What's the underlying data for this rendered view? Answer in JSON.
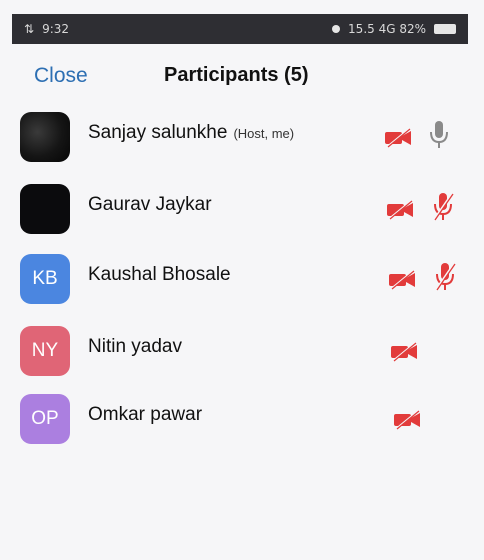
{
  "status_bar": {
    "time": "9:32",
    "right_text": "15.5 4G 82%"
  },
  "header": {
    "close_label": "Close",
    "title": "Participants (5)"
  },
  "participants": [
    {
      "name": "Sanjay salunkhe",
      "tag": "(Host, me)",
      "initials": "",
      "avatar_color": "#111111",
      "video_off": true,
      "mic_muted": false
    },
    {
      "name": "Gaurav Jaykar",
      "tag": "",
      "initials": "",
      "avatar_color": "#0b0b0d",
      "video_off": true,
      "mic_muted": true
    },
    {
      "name": "Kaushal Bhosale",
      "tag": "",
      "initials": "KB",
      "avatar_color": "#4b86e0",
      "video_off": true,
      "mic_muted": true
    },
    {
      "name": "Nitin yadav",
      "tag": "",
      "initials": "NY",
      "avatar_color": "#e06576",
      "video_off": true,
      "mic_muted": null
    },
    {
      "name": "Omkar pawar",
      "tag": "",
      "initials": "OP",
      "avatar_color": "#ab7fe0",
      "video_off": true,
      "mic_muted": null
    }
  ],
  "colors": {
    "accent": "#2d6fb3",
    "muted_red": "#e23b3b",
    "mic_gray": "#8a8a8a"
  }
}
